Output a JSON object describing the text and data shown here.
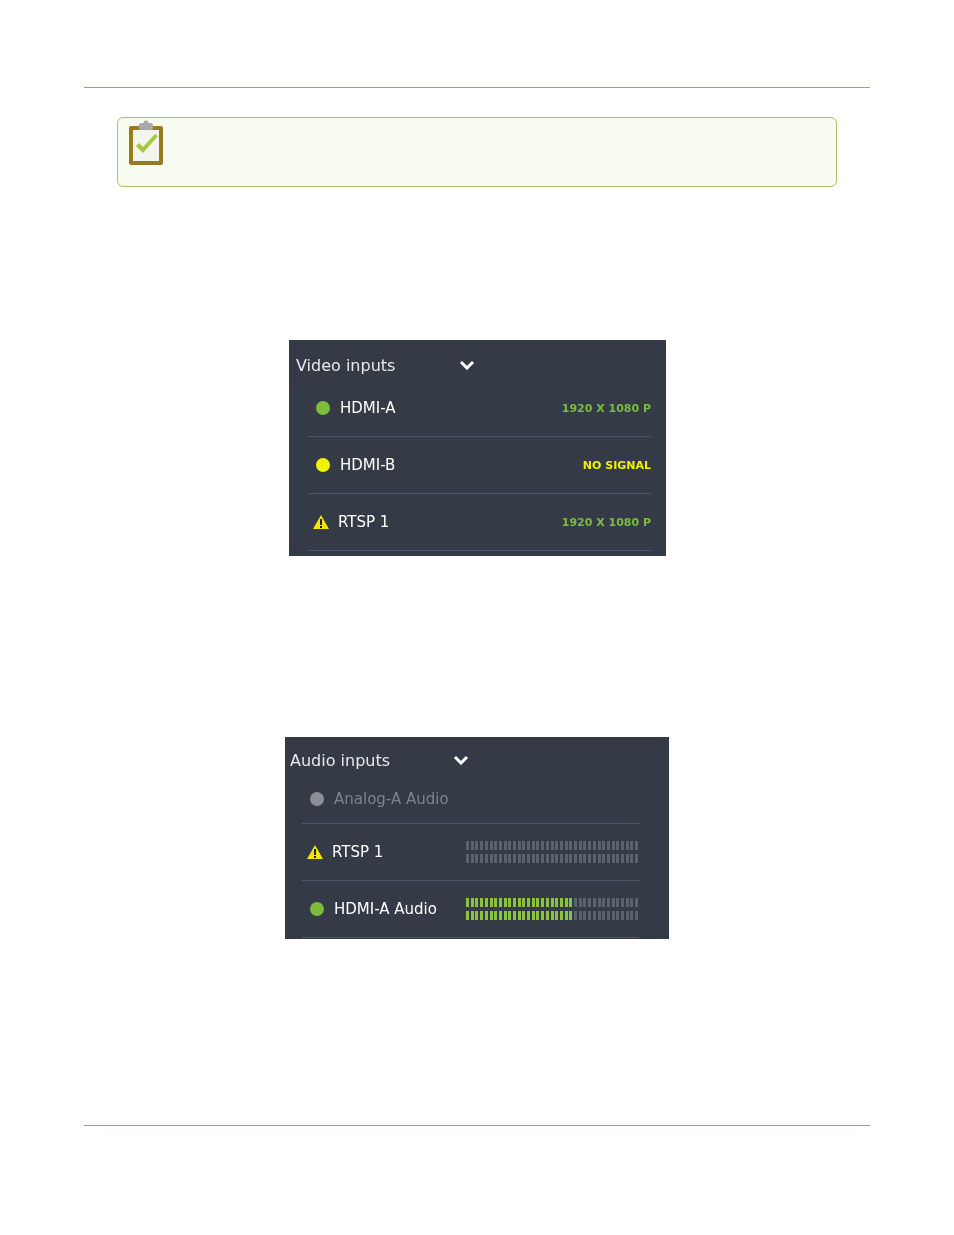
{
  "video_inputs": {
    "title": "Video inputs",
    "rows": [
      {
        "kind": "dot",
        "name": "HDMI-A",
        "color": "#7dbb3c",
        "status": "1920 X 1080 P",
        "no_signal": false
      },
      {
        "kind": "dot",
        "name": "HDMI-B",
        "color": "#f2f200",
        "status": "NO SIGNAL",
        "no_signal": true
      },
      {
        "kind": "warning",
        "name": "RTSP 1",
        "status": "1920 X 1080 P",
        "no_signal": false
      }
    ]
  },
  "audio_inputs": {
    "title": "Audio inputs",
    "rows": [
      {
        "kind": "dot",
        "name": "Analog-A Audio",
        "color": "#8a8f96",
        "disabled": true
      },
      {
        "kind": "warning",
        "name": "RTSP 1",
        "disabled": false,
        "meters": [
          {
            "active": false
          },
          {
            "active": false
          }
        ]
      },
      {
        "kind": "dot",
        "name": "HDMI-A Audio",
        "color": "#7dbb3c",
        "disabled": false,
        "meters": [
          {
            "active": true,
            "level": 0.62
          },
          {
            "active": true,
            "level": 0.62
          }
        ]
      }
    ]
  }
}
